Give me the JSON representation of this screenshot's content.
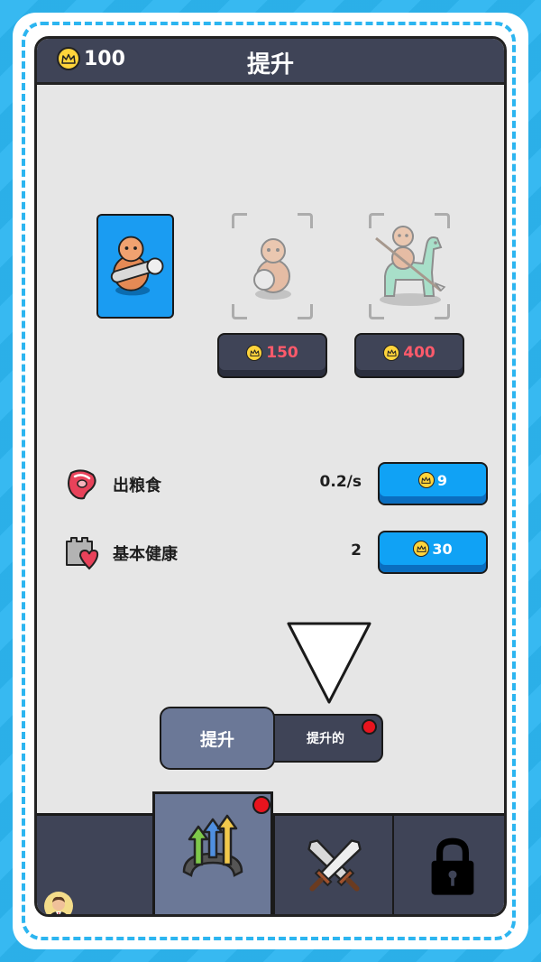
{
  "header": {
    "title": "提升",
    "coins": "100"
  },
  "units": [
    {
      "name": "clubman",
      "state": "owned"
    },
    {
      "name": "shield-man",
      "state": "locked",
      "price": "150"
    },
    {
      "name": "dino-rider",
      "state": "locked",
      "price": "400"
    }
  ],
  "stats": [
    {
      "label": "出粮食",
      "value": "0.2/s",
      "cost": "9",
      "icon": "meat-icon"
    },
    {
      "label": "基本健康",
      "value": "2",
      "cost": "30",
      "icon": "castle-heart-icon"
    }
  ],
  "subtabs": {
    "active": "提升",
    "inactive": "提升的"
  },
  "bottom_nav": [
    {
      "name": "profile",
      "icon": "avatar-icon",
      "active": false
    },
    {
      "name": "upgrades",
      "icon": "upgrade-arrows-icon",
      "active": true,
      "badge": true
    },
    {
      "name": "battle",
      "icon": "crossed-swords-icon",
      "active": false
    },
    {
      "name": "locked",
      "icon": "padlock-icon",
      "active": false
    }
  ],
  "colors": {
    "background": "#2cb5f0",
    "topbar": "#3f4457",
    "accent_blue": "#10a2f5",
    "price_red": "#ff5a6b",
    "coin_gold": "#ffd43b",
    "badge_red": "#e8141e"
  }
}
